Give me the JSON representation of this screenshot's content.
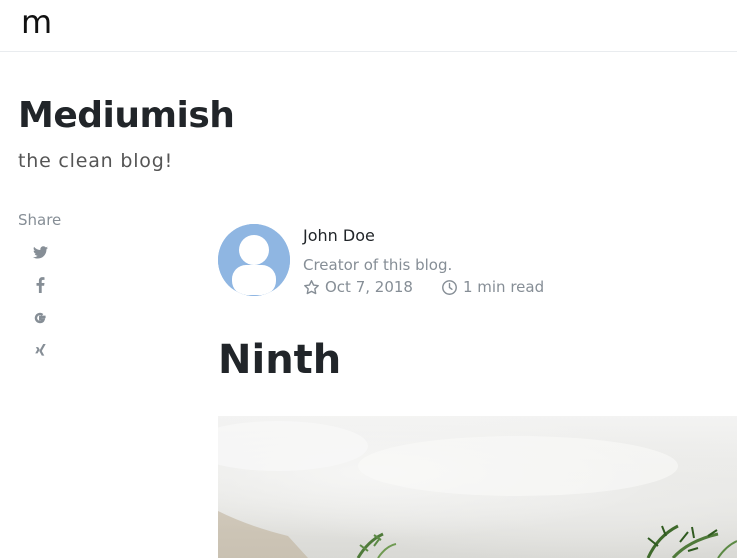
{
  "topbar": {
    "logo": "m"
  },
  "site": {
    "title": "Mediumish",
    "tagline": "the clean blog!"
  },
  "share": {
    "label": "Share",
    "icons": [
      "twitter-icon",
      "facebook-icon",
      "google-icon",
      "xing-icon"
    ]
  },
  "author": {
    "name": "John Doe",
    "description": "Creator of this blog.",
    "avatar_icon": "user-avatar-icon"
  },
  "post": {
    "date": "Oct 7, 2018",
    "date_icon": "star-icon",
    "read_time": "1 min read",
    "read_icon": "clock-icon",
    "title": "Ninth"
  },
  "colors": {
    "text": "#212529",
    "muted": "#868e96",
    "avatar_bg": "#8fb6e2",
    "border": "#e9ecef"
  }
}
